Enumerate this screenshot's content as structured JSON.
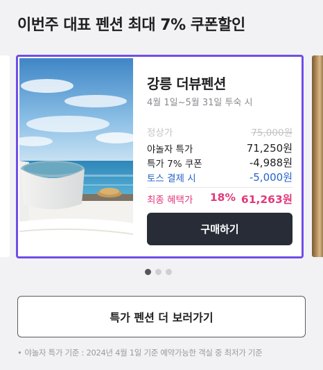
{
  "section": {
    "title": "이번주 대표 펜션 최대 7% 쿠폰할인"
  },
  "card": {
    "name": "강릉 더뷰펜션",
    "period": "4월 1일~5월 31일 투숙 시",
    "regular_label": "정상가",
    "regular_price": "75,000원",
    "sale_label": "야놀자 특가",
    "sale_price": "71,250원",
    "coupon_label": "특가 7% 쿠폰",
    "coupon_discount": "-4,988원",
    "toss_label": "토스 결제 시",
    "toss_discount": "-5,000원",
    "final_label": "최종 혜택가",
    "final_percent": "18%",
    "final_price": "61,263원",
    "buy_label": "구매하기",
    "highlight_color": "#6f4de8"
  },
  "pagination": {
    "count": 3,
    "active": 1
  },
  "more_button": {
    "label": "특가 펜션 더 보러가기"
  },
  "footnote": {
    "bullet": "•",
    "text": "야놀자 특가 기준 : 2024년 4월 1일 기준 예약가능한 객실 중 최저가 기준"
  }
}
